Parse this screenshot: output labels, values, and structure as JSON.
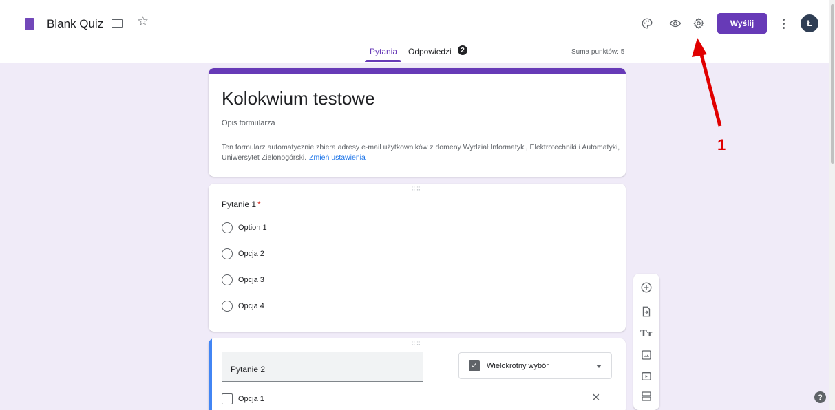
{
  "header": {
    "title": "Blank Quiz",
    "send_label": "Wyślij",
    "avatar_letter": "Ł",
    "icons": [
      "docs-icon",
      "folder-icon",
      "star-icon",
      "palette-icon",
      "eye-icon",
      "gear-icon",
      "more-vert-icon"
    ]
  },
  "tabs": {
    "questions": "Pytania",
    "responses": "Odpowiedzi",
    "responses_count": "2",
    "points_total": "Suma punktów: 5"
  },
  "form": {
    "title": "Kolokwium testowe",
    "description": "Opis formularza",
    "email_notice": "Ten formularz automatycznie zbiera adresy e-mail użytkowników z domeny Wydział Informatyki, Elektrotechniki i Automatyki, Uniwersytet Zielonogórski.",
    "change_settings_link": "Zmień ustawienia"
  },
  "question1": {
    "title": "Pytanie 1",
    "required_mark": "*",
    "options": [
      "Option 1",
      "Opcja 2",
      "Opcja 3",
      "Opcja 4"
    ]
  },
  "question2": {
    "title": "Pytanie 2",
    "type": "Wielokrotny wybór",
    "options": [
      "Opcja 1"
    ]
  },
  "side_toolbar": {
    "icons": [
      "add-question-icon",
      "import-questions-icon",
      "add-title-icon",
      "add-image-icon",
      "add-video-icon",
      "add-section-icon"
    ]
  },
  "annotation": {
    "label": "1",
    "color": "#e00000"
  },
  "colors": {
    "accent": "#673ab7",
    "background": "#f0ebf8",
    "active_question": "#4285f4"
  }
}
